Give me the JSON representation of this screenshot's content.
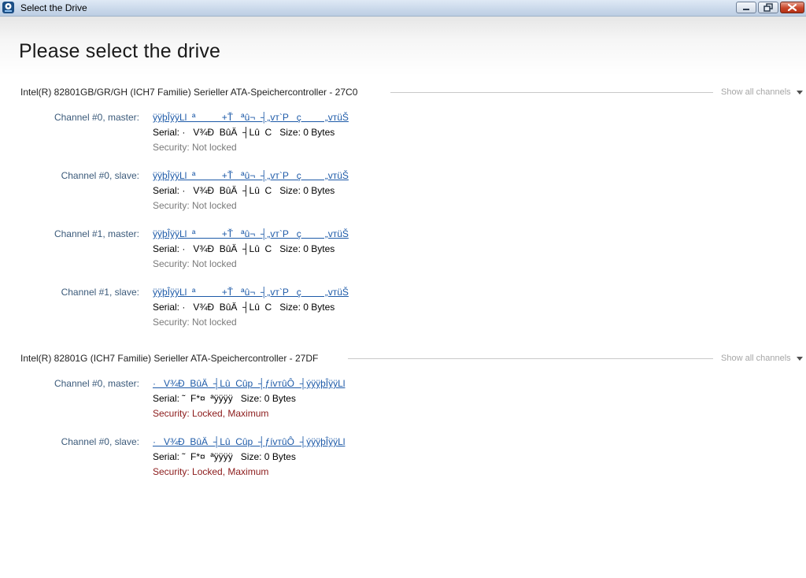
{
  "window": {
    "title": "Select the Drive"
  },
  "page_title": "Please select the drive",
  "controllers": [
    {
      "title": "Intel(R) 82801GB/GR/GH (ICH7 Familie) Serieller ATA-Speichercontroller - 27C0",
      "show_all": "Show all channels",
      "drives": [
        {
          "channel": "Channel #0, master:",
          "name": "ÿÿþÎÿÿLl  ª          +Ť   ªû¬  ┤„vт`P   ç         „vтüŠ",
          "serial": "Serial: ·   V¾Ð  BûÄ  ┤Lû  C   Size: 0 Bytes",
          "security": "Security: Not locked"
        },
        {
          "channel": "Channel #0, slave:",
          "name": "ÿÿþÎÿÿLl  ª          +Ť   ªû¬  ┤„vт`P   ç         „vтüŠ",
          "serial": "Serial: ·   V¾Ð  BûÄ  ┤Lû  C   Size: 0 Bytes",
          "security": "Security: Not locked"
        },
        {
          "channel": "Channel #1, master:",
          "name": "ÿÿþÎÿÿLl  ª          +Ť   ªû¬  ┤„vт`P   ç         „vтüŠ",
          "serial": "Serial: ·   V¾Ð  BûÄ  ┤Lû  C   Size: 0 Bytes",
          "security": "Security: Not locked"
        },
        {
          "channel": "Channel #1, slave:",
          "name": "ÿÿþÎÿÿLl  ª          +Ť   ªû¬  ┤„vт`P   ç         „vтüŠ",
          "serial": "Serial: ·   V¾Ð  BûÄ  ┤Lû  C   Size: 0 Bytes",
          "security": "Security: Not locked"
        }
      ]
    },
    {
      "title": "Intel(R) 82801G (ICH7 Familie) Serieller ATA-Speichercontroller - 27DF",
      "show_all": "Show all channels",
      "drives": [
        {
          "channel": "Channel #0, master:",
          "name": "·   V¾Ð  BûÄ  ┤Lû  Cûp  ┤ƒívтûÔ  ┤ýÿÿþÎÿÿLl",
          "serial": "Serial: ˜  F*¤  ªÿÿÿÿ   Size: 0 Bytes",
          "security": "Security: Locked, Maximum"
        },
        {
          "channel": "Channel #0, slave:",
          "name": "·   V¾Ð  BûÄ  ┤Lû  Cûp  ┤ƒívтûÔ  ┤ýÿÿþÎÿÿLl",
          "serial": "Serial: ˜  F*¤  ªÿÿÿÿ   Size: 0 Bytes",
          "security": "Security: Locked, Maximum"
        }
      ]
    }
  ],
  "icons": {
    "app": "app-icon",
    "minimize": "minimize-icon",
    "maximize": "restore-icon",
    "close": "close-icon",
    "chevron": "chevron-down-icon"
  },
  "colors": {
    "link": "#1d5aa8",
    "locked": "#8b1a1a",
    "unlocked": "#7a7a7a",
    "channel_label": "#3b5a7a"
  }
}
